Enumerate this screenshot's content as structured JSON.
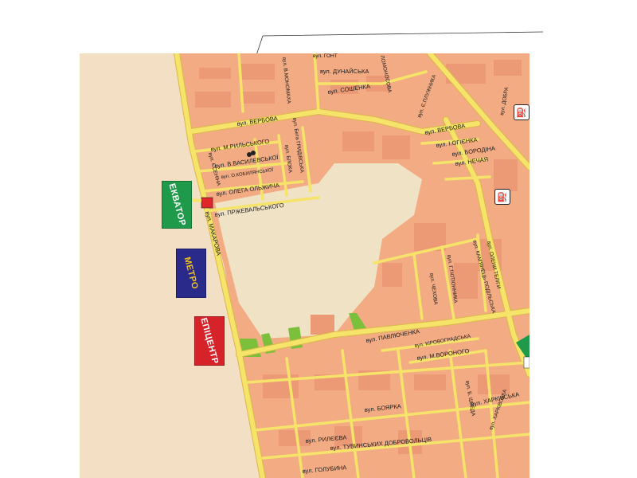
{
  "signs": {
    "ekvator": "ЕКВАТОР",
    "metro": "МЕТРО",
    "epicentr": "ЕПІЦЕНТР"
  },
  "streets": {
    "verbova_1": "вул. ВЕРБОВА",
    "verbova_2": "вул. ВЕРБОВА",
    "rylskoho": "вул. М.РИЛЬСЬКОГО",
    "vasylevskoi": "вул. В.ВАСИЛЕВСЬКОЇ",
    "kobylianskoi": "вул. О.КОБИЛЯНСЬКОЇ",
    "olzhycha": "вул. ОЛЕГА ОЛЬЖИЧА",
    "przhevalskoho": "вул. ПРЖЕВАЛЬСЬКОГО",
    "yesenina": "вул. ЄСЕНІНА",
    "makarova": "вул. МАКАРОВА",
    "bloka": "вул. БЛОКА",
    "hrydivska": "вул. Бета ГРИДІВСЬКА",
    "monomakha": "вул. В.МОНОМАХА",
    "dunaiska": "вул. ДУНАЙСЬКА",
    "soshenka": "вул. СОШЕНКА",
    "lomonosova": "ЛОМОНОСОВА",
    "pluzhnyka": "вул. Є.ПЛУЖНИКА",
    "ohonka": "вул. І.ОГІЄНКА",
    "borodina": "вул. БОРОДІНА",
    "nechaia": "вул. НЕЧАЯ",
    "dobra": "вул. ДОБРА",
    "kamianets": "вул. КАМ'ЯНЕЦЬ-ПОДІЛЬСЬКА",
    "tiutiunnyka": "вул. Г.ТЮТЮННИКА",
    "chekhova": "вул. ЧЕХОВА",
    "pavliuchenka": "вул. ПАВЛЮЧЕНКА",
    "kirovohradska": "вул. КІРОВОГРАДСЬКА",
    "voronoho": "вул. М.ВОРОНОГО",
    "boiarka": "вул. БОЯРКА",
    "shveda": "вул. Б. ШВЕДА",
    "kharkivska_1": "вул. ХАРКІВСЬКА",
    "kharkivska_2": "вул. ХАРКІВСЬКА",
    "rylieieva": "вул. РИЛЄЄВА",
    "tuvynskykh": "вул. ТУВИНСЬКИХ ДОБРОВОЛЬЦІВ",
    "holubyna": "вул. ГОЛУБИНА",
    "olenyteliha": "вул. ОЛЕНИ ТЕЛІГИ",
    "ustyma": "вул. Т.О...",
    "hont": "вул. ГОНТ"
  },
  "icons": [
    "fuel-station-icon",
    "fuel-station-icon",
    "metro-marker-icon",
    "target-marker"
  ],
  "colors": {
    "land": "#f3dfc4",
    "block": "#f3ab83",
    "building": "#ec9a75",
    "road": "#f6e36a",
    "road_border": "#d9b84a",
    "park": "#7cbf3b",
    "empty_area": "#f0e2c4",
    "ekvator": "#1f9a4a",
    "metro": "#2a2a8a",
    "epicentr": "#d6232a",
    "marker": "#e0262b"
  }
}
